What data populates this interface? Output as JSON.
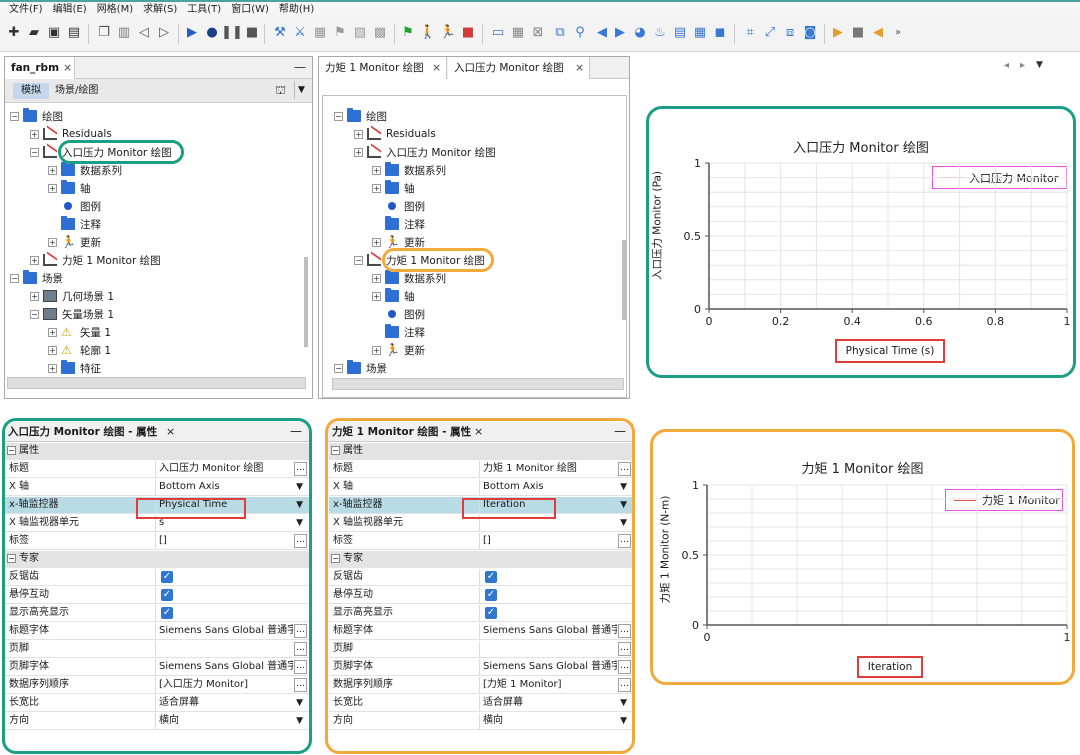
{
  "menu": [
    "文件(F)",
    "编辑(E)",
    "网格(M)",
    "求解(S)",
    "工具(T)",
    "窗口(W)",
    "帮助(H)"
  ],
  "left_tree": {
    "tab_label": "fan_rbm",
    "tab_close": "×",
    "mode_tab": "模拟",
    "mode_label": "场景/绘图",
    "rows": [
      {
        "label": "绘图"
      },
      {
        "label": "Residuals"
      },
      {
        "label": "入口压力 Monitor 绘图"
      },
      {
        "label": "数据系列"
      },
      {
        "label": "轴"
      },
      {
        "label": "图例"
      },
      {
        "label": "注释"
      },
      {
        "label": "更新"
      },
      {
        "label": "力矩 1 Monitor 绘图"
      },
      {
        "label": "场景"
      },
      {
        "label": "几何场景 1"
      },
      {
        "label": "矢量场景 1"
      },
      {
        "label": "矢量 1"
      },
      {
        "label": "轮廓 1"
      },
      {
        "label": "特征"
      }
    ]
  },
  "center_tree": {
    "tabs": [
      {
        "label": "力矩 1 Monitor 绘图"
      },
      {
        "label": "入口压力 Monitor 绘图"
      }
    ],
    "rows": [
      {
        "label": "绘图"
      },
      {
        "label": "Residuals"
      },
      {
        "label": "入口压力 Monitor 绘图"
      },
      {
        "label": "数据系列"
      },
      {
        "label": "轴"
      },
      {
        "label": "图例"
      },
      {
        "label": "注释"
      },
      {
        "label": "更新"
      },
      {
        "label": "力矩 1 Monitor 绘图"
      },
      {
        "label": "数据系列"
      },
      {
        "label": "轴"
      },
      {
        "label": "图例"
      },
      {
        "label": "注释"
      },
      {
        "label": "更新"
      },
      {
        "label": "场景"
      }
    ]
  },
  "props_left": {
    "title": "入口压力 Monitor 绘图 - 属性",
    "rows": [
      {
        "name": "属性",
        "value": ""
      },
      {
        "name": "标题",
        "value": "入口压力 Monitor 绘图"
      },
      {
        "name": "X 轴",
        "value": "Bottom Axis"
      },
      {
        "name": "x-轴监控器",
        "value": "Physical Time"
      },
      {
        "name": "X 轴监视器单元",
        "value": "s"
      },
      {
        "name": "标签",
        "value": "[]"
      },
      {
        "name": "专家",
        "value": ""
      },
      {
        "name": "反锯齿",
        "value": ""
      },
      {
        "name": "悬停互动",
        "value": ""
      },
      {
        "name": "显示高亮显示",
        "value": ""
      },
      {
        "name": "标题字体",
        "value": "Siemens Sans Global 普通字..."
      },
      {
        "name": "页脚",
        "value": ""
      },
      {
        "name": "页脚字体",
        "value": "Siemens Sans Global 普通字..."
      },
      {
        "name": "数据序列顺序",
        "value": "[入口压力 Monitor]"
      },
      {
        "name": "长宽比",
        "value": "适合屏幕"
      },
      {
        "name": "方向",
        "value": "横向"
      }
    ]
  },
  "props_right": {
    "title": "力矩 1 Monitor 绘图 - 属性",
    "rows": [
      {
        "name": "属性",
        "value": ""
      },
      {
        "name": "标题",
        "value": "力矩 1 Monitor 绘图"
      },
      {
        "name": "X 轴",
        "value": "Bottom Axis"
      },
      {
        "name": "x-轴监控器",
        "value": "Iteration"
      },
      {
        "name": "X 轴监视器单元",
        "value": ""
      },
      {
        "name": "标签",
        "value": "[]"
      },
      {
        "name": "专家",
        "value": ""
      },
      {
        "name": "反锯齿",
        "value": ""
      },
      {
        "name": "悬停互动",
        "value": ""
      },
      {
        "name": "显示高亮显示",
        "value": ""
      },
      {
        "name": "标题字体",
        "value": "Siemens Sans Global 普通字..."
      },
      {
        "name": "页脚",
        "value": ""
      },
      {
        "name": "页脚字体",
        "value": "Siemens Sans Global 普通字..."
      },
      {
        "name": "数据序列顺序",
        "value": "[力矩 1 Monitor]"
      },
      {
        "name": "长宽比",
        "value": "适合屏幕"
      },
      {
        "name": "方向",
        "value": "横向"
      }
    ]
  },
  "colors": {
    "teal": "#1a9e86",
    "orange": "#f2a93b",
    "red": "#e03c3c",
    "magenta": "#e84de8",
    "series": "#e35a44"
  },
  "chart_data": [
    {
      "type": "line",
      "title": "入口压力 Monitor 绘图",
      "xlabel": "Physical Time (s)",
      "ylabel": "入口压力 Monitor (Pa)",
      "xlim": [
        0,
        1
      ],
      "ylim": [
        0,
        1
      ],
      "xticks": [
        "0",
        "0.2",
        "0.4",
        "0.6",
        "0.8",
        "1"
      ],
      "yticks": [
        "0",
        "0.5",
        "1"
      ],
      "grid": true,
      "legend_position": "top-right",
      "series": [
        {
          "name": "入口压力 Monitor",
          "x": [],
          "y": []
        }
      ]
    },
    {
      "type": "line",
      "title": "力矩 1 Monitor 绘图",
      "xlabel": "Iteration",
      "ylabel": "力矩 1 Monitor (N-m)",
      "xlim": [
        0,
        1
      ],
      "ylim": [
        0,
        1
      ],
      "xticks": [
        "0",
        "1"
      ],
      "yticks": [
        "0",
        "0.5",
        "1"
      ],
      "grid": true,
      "legend_position": "top-right",
      "series": [
        {
          "name": "力矩 1 Monitor",
          "x": [],
          "y": []
        }
      ]
    }
  ]
}
